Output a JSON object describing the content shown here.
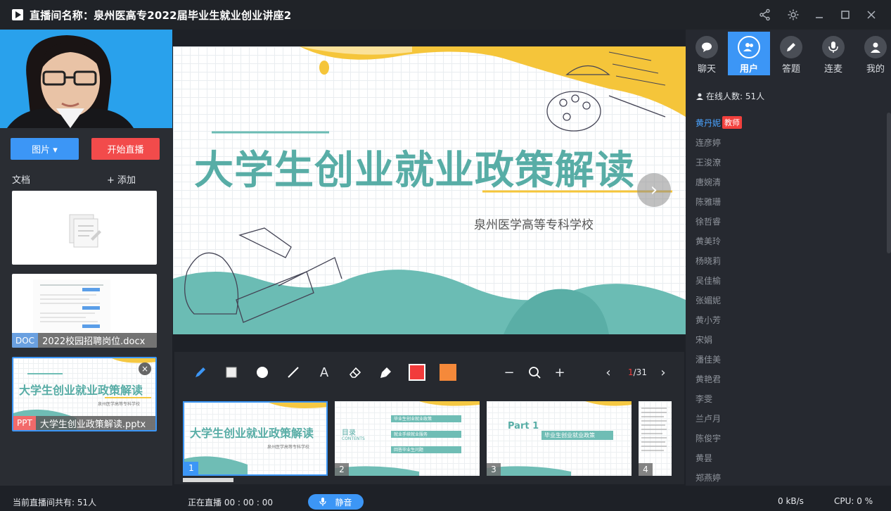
{
  "window": {
    "title": "直播间名称：泉州医高专2022届毕业生就业创业讲座2"
  },
  "left": {
    "pic_button": "图片 ▾",
    "start_live": "开始直播",
    "docs_label": "文档",
    "add_label": "+ 添加",
    "docs": [
      {
        "tag": "",
        "name": ""
      },
      {
        "tag": "DOC",
        "name": "2022校园招聘岗位.docx",
        "tag_color": "#6aa0e0"
      },
      {
        "tag": "PPT",
        "name": "大学生创业政策解读.pptx",
        "tag_color": "#f26a6a"
      }
    ]
  },
  "slide": {
    "title": "大学生创业就业政策解读",
    "school": "泉州医学高等专科学校"
  },
  "toolbar": {
    "page_current": "1",
    "page_total": "/31",
    "active_color": "#f23b3b",
    "alt_color": "#f5893a"
  },
  "thumbs": [
    {
      "num": "1",
      "title": "大学生创业就业政策解读",
      "sub": "泉州医学高等专科学校"
    },
    {
      "num": "2",
      "title": "目录",
      "sub": "CONTENTS",
      "items": [
        "毕业生创业就业政策",
        "就业手续就业服务",
        "回答毕业生问题"
      ]
    },
    {
      "num": "3",
      "title": "Part 1",
      "sub": "毕业生创业就业政策"
    },
    {
      "num": "4",
      "title": "",
      "sub": ""
    }
  ],
  "right": {
    "tabs": [
      {
        "label": "聊天",
        "icon": "chat-icon"
      },
      {
        "label": "用户",
        "icon": "users-icon"
      },
      {
        "label": "答题",
        "icon": "pen-icon"
      },
      {
        "label": "连麦",
        "icon": "mic-icon"
      },
      {
        "label": "我的",
        "icon": "person-icon"
      }
    ],
    "online": "在线人数: 51人",
    "teacher": {
      "name": "黄丹妮",
      "badge": "教师"
    },
    "users": [
      "连彦婷",
      "王浚潦",
      "唐婉清",
      "陈雅珊",
      "徐哲睿",
      "黄美玲",
      "杨晓莉",
      "吴佳榆",
      "张媚妮",
      "黄小芳",
      "宋娟",
      "潘佳美",
      "黄艳君",
      "李雯",
      "兰卢月",
      "陈俊宇",
      "黄昙",
      "郑燕婷"
    ]
  },
  "status": {
    "count": "当前直播间共有: 51人",
    "live": "正在直播 00 : 00 : 00",
    "mute": "静音",
    "rate": "0 kB/s",
    "cpu": "CPU:  0 %"
  }
}
